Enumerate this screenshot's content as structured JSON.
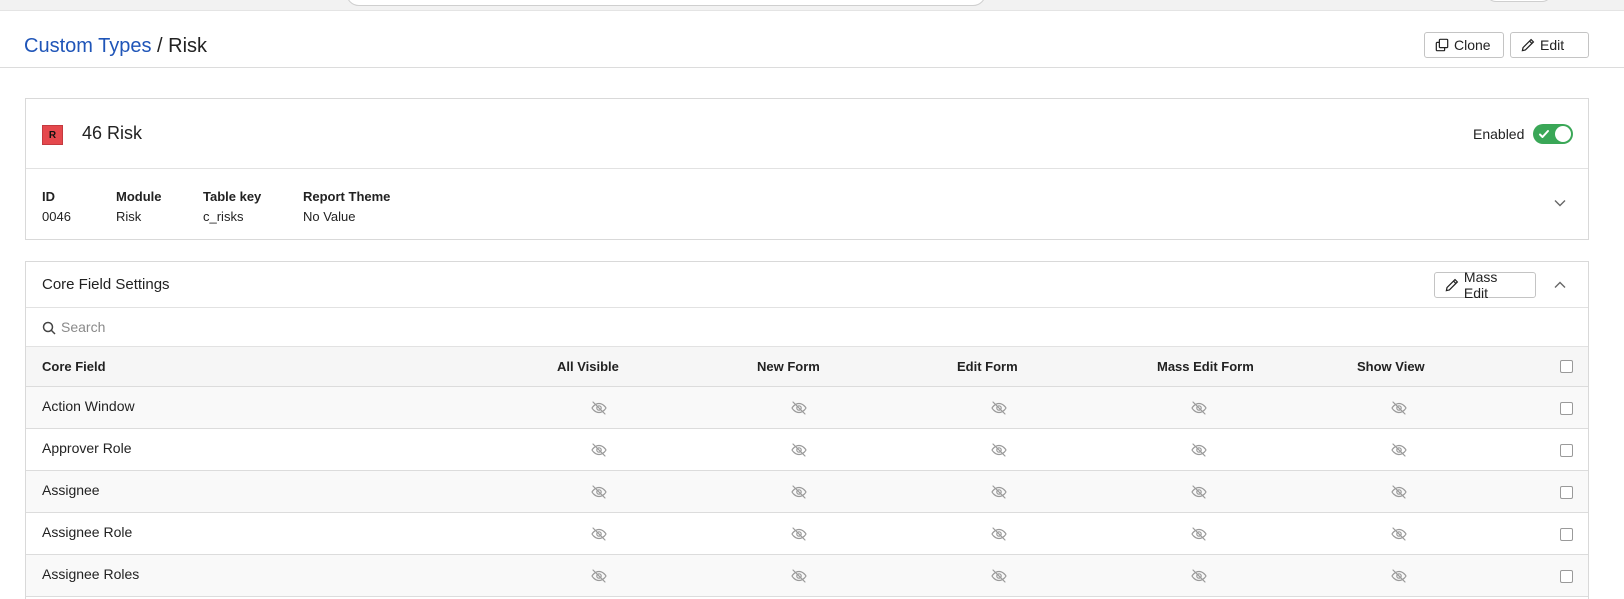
{
  "header": {
    "breadcrumb_link": "Custom Types",
    "breadcrumb_sep": " / ",
    "breadcrumb_current": "Risk",
    "clone_label": "Clone",
    "edit_label": "Edit"
  },
  "type_card": {
    "badge": "R",
    "badge_color": "#e5484d",
    "title": "46 Risk",
    "enabled_label": "Enabled",
    "enabled": true,
    "toggle_color": "#3aa757",
    "meta": {
      "id_label": "ID",
      "id_value": "0046",
      "module_label": "Module",
      "module_value": "Risk",
      "table_key_label": "Table key",
      "table_key_value": "c_risks",
      "report_theme_label": "Report Theme",
      "report_theme_value": "No Value"
    }
  },
  "core_fields": {
    "title": "Core Field Settings",
    "mass_edit_label": "Mass Edit",
    "search_placeholder": "Search",
    "columns": [
      "Core Field",
      "All Visible",
      "New Form",
      "Edit Form",
      "Mass Edit Form",
      "Show View"
    ],
    "visibility_icon": "eye-slash-icon",
    "rows": [
      {
        "name": "Action Window"
      },
      {
        "name": "Approver Role"
      },
      {
        "name": "Assignee"
      },
      {
        "name": "Assignee Role"
      },
      {
        "name": "Assignee Roles"
      }
    ]
  },
  "colors": {
    "link": "#1f55b8"
  }
}
